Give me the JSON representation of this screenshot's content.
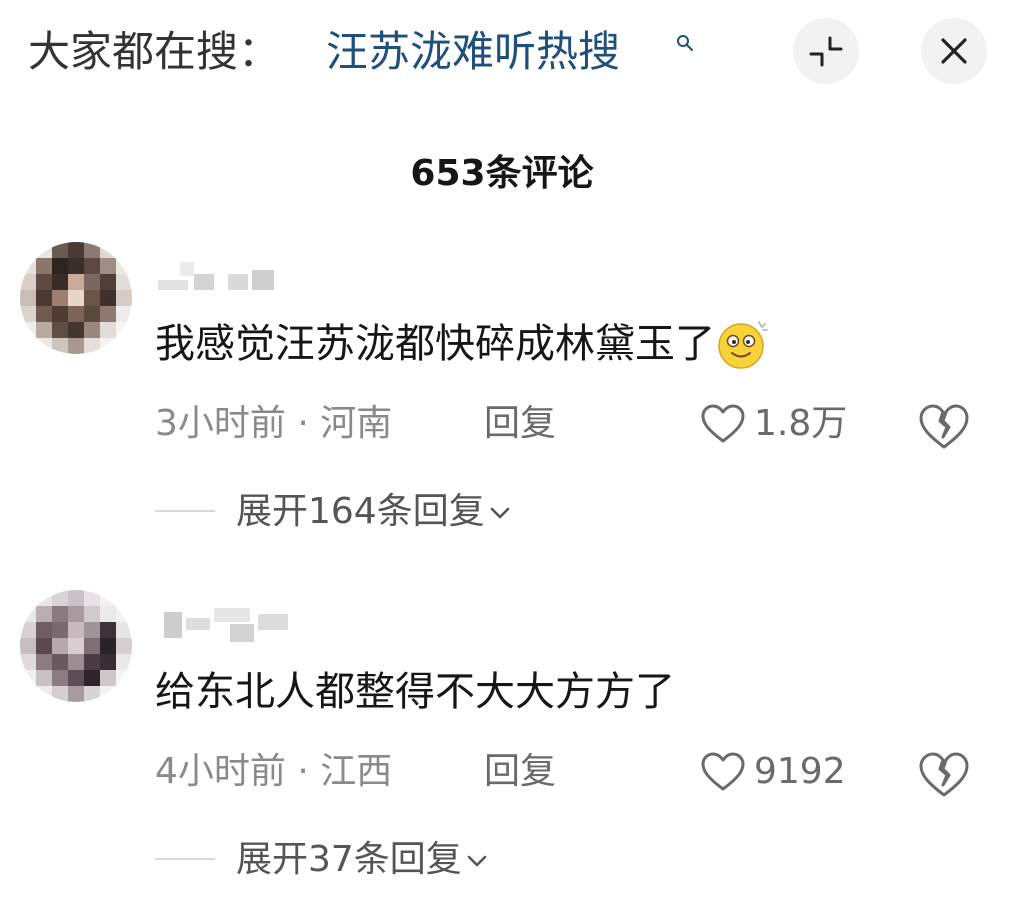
{
  "search_bar": {
    "prefix": "大家都在搜：",
    "term": "汪苏泷难听热搜",
    "icon": "search-icon"
  },
  "actions": {
    "collapse_icon": "collapse-icon",
    "close_icon": "close-icon"
  },
  "comments_header": {
    "count_label": "653条评论"
  },
  "comments": [
    {
      "avatar": "avatar-pixelated",
      "username": "",
      "text": "我感觉汪苏泷都快碎成林黛玉了",
      "emoji": "dizzy-face-emoji",
      "time": "3小时前",
      "separator": " · ",
      "location": "河南",
      "reply_label": "回复",
      "like_count": "1.8万",
      "expand_label": "展开164条回复"
    },
    {
      "avatar": "avatar-pixelated",
      "username": "",
      "text": "给东北人都整得不大大方方了",
      "time": "4小时前",
      "separator": " · ",
      "location": "江西",
      "reply_label": "回复",
      "like_count": "9192",
      "expand_label": "展开37条回复"
    }
  ],
  "colors": {
    "search_term": "#1f4f7c",
    "text_primary": "#161616",
    "text_secondary": "#8a8a8a",
    "button_bg": "#f2f2f2"
  }
}
